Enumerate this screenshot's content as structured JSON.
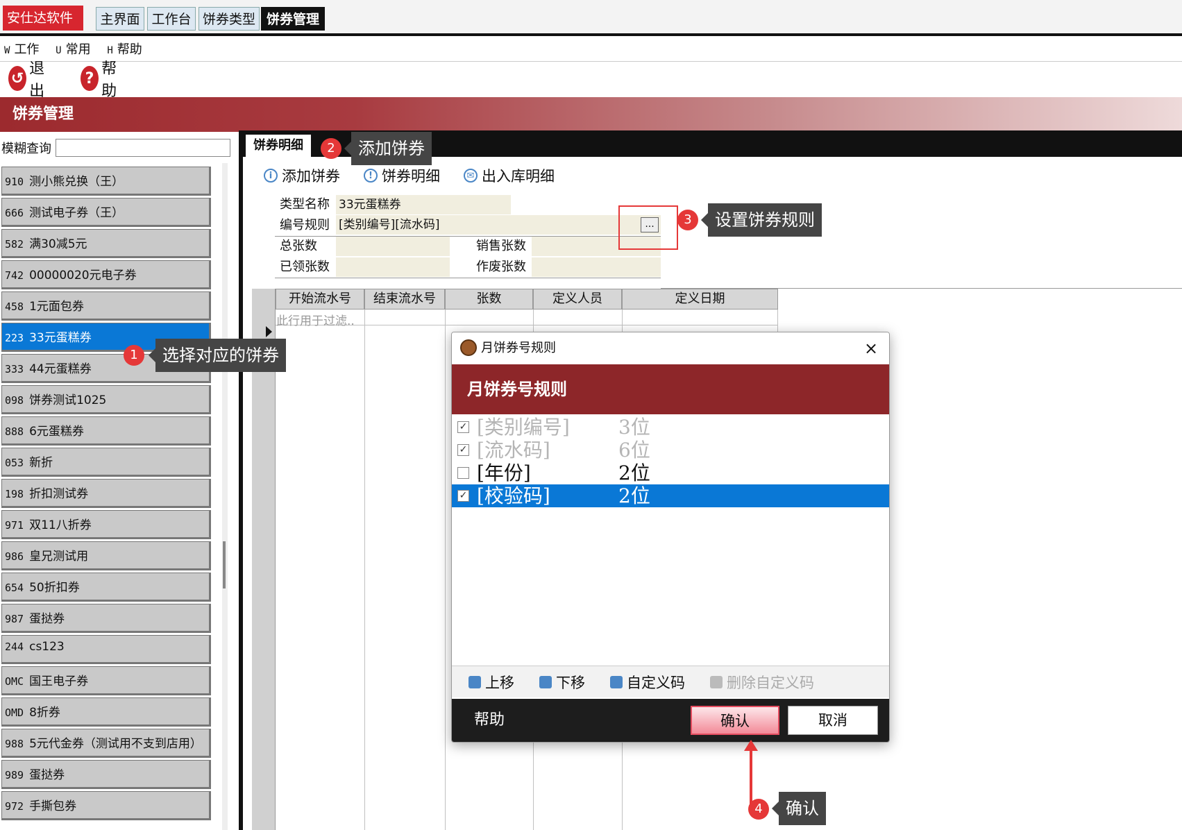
{
  "topbar": {
    "brand": "安仕达软件",
    "tabs": [
      "主界面",
      "工作台",
      "饼券类型",
      "饼券管理"
    ]
  },
  "menubar": [
    {
      "key": "W",
      "label": "工作"
    },
    {
      "key": "U",
      "label": "常用"
    },
    {
      "key": "H",
      "label": "帮助"
    }
  ],
  "toolbar": {
    "exit": "退出",
    "help": "帮助"
  },
  "window_title": "饼券管理",
  "left": {
    "filter_label": "模糊查询",
    "filter_value": "",
    "items": [
      {
        "code": "910",
        "name": "测小熊兑换（王）"
      },
      {
        "code": "666",
        "name": "测试电子券（王）"
      },
      {
        "code": "582",
        "name": "满30减5元"
      },
      {
        "code": "742",
        "name": "00000020元电子券"
      },
      {
        "code": "458",
        "name": "1元面包券"
      },
      {
        "code": "223",
        "name": "33元蛋糕券"
      },
      {
        "code": "333",
        "name": "44元蛋糕券"
      },
      {
        "code": "098",
        "name": "饼券测试1025"
      },
      {
        "code": "888",
        "name": "6元蛋糕券"
      },
      {
        "code": "053",
        "name": "新折"
      },
      {
        "code": "198",
        "name": "折扣测试券"
      },
      {
        "code": "971",
        "name": "双11八折券"
      },
      {
        "code": "986",
        "name": "皇兄测试用"
      },
      {
        "code": "654",
        "name": "50折扣券"
      },
      {
        "code": "987",
        "name": "蛋挞券"
      },
      {
        "code": "244",
        "name": "cs123"
      },
      {
        "code": "OMC",
        "name": "国王电子券"
      },
      {
        "code": "OMD",
        "name": "8折券"
      },
      {
        "code": "988",
        "name": "5元代金券（测试用不支到店用）"
      },
      {
        "code": "989",
        "name": "蛋挞券"
      },
      {
        "code": "972",
        "name": "手撕包券"
      }
    ],
    "selected_index": 5
  },
  "detail": {
    "tab": "饼券明细",
    "tools": [
      "添加饼券",
      "饼券明细",
      "出入库明细"
    ],
    "fields": {
      "type_name_label": "类型名称",
      "type_name": "33元蛋糕券",
      "rule_label": "编号规则",
      "rule": "[类别编号][流水码]",
      "rule_button": "...",
      "total_label": "总张数",
      "total": "",
      "sold_label": "销售张数",
      "sold": "",
      "received_label": "已领张数",
      "received": "",
      "void_label": "作废张数",
      "void": ""
    },
    "grid": {
      "headers": [
        "开始流水号",
        "结束流水号",
        "张数",
        "定义人员",
        "定义日期"
      ],
      "filter_row": "此行用于过滤.."
    }
  },
  "dialog": {
    "title": "月饼券号规则",
    "header": "月饼券号规则",
    "close": "×",
    "rules": [
      {
        "name": "[类别编号]",
        "length": "3位",
        "checked": true,
        "disabled": true,
        "selected": false
      },
      {
        "name": "[流水码]",
        "length": "6位",
        "checked": true,
        "disabled": true,
        "selected": false
      },
      {
        "name": "[年份]",
        "length": "2位",
        "checked": false,
        "disabled": false,
        "selected": false
      },
      {
        "name": "[校验码]",
        "length": "2位",
        "checked": true,
        "disabled": false,
        "selected": true
      }
    ],
    "tools": [
      "上移",
      "下移",
      "自定义码",
      "删除自定义码"
    ],
    "help": "帮助",
    "ok": "确认",
    "cancel": "取消"
  },
  "annotations": [
    {
      "num": "1",
      "text": "选择对应的饼券"
    },
    {
      "num": "2",
      "text": "添加饼券"
    },
    {
      "num": "3",
      "text": "设置饼券规则"
    },
    {
      "num": "4",
      "text": "确认"
    }
  ],
  "colors": {
    "accent": "#8d2629",
    "selection": "#0a78d6",
    "annotation": "#e53838"
  }
}
